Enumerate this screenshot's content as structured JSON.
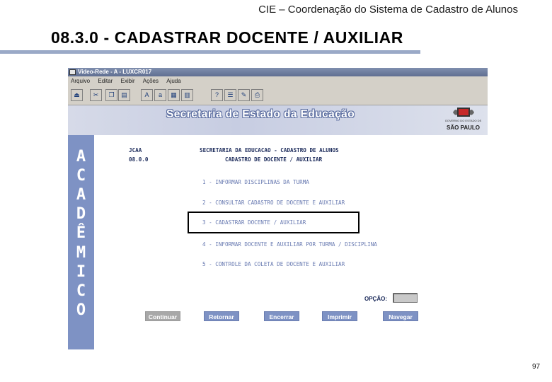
{
  "slide": {
    "header_title": "CIE – Coordenação do Sistema de Cadastro de Alunos",
    "section_title": "08.3.0  -  CADASTRAR DOCENTE / AUXILIAR",
    "page_number": "97"
  },
  "window": {
    "title": "Video-Rede - A - LUXCR017",
    "menu": [
      "Arquivo",
      "Editar",
      "Exibir",
      "Ações",
      "Ajuda"
    ],
    "banner_title": "Secretaria de Estado da Educação",
    "seal_caption": "GOVERNO DO ESTADO DE",
    "seal_state": "SÃO PAULO",
    "sidebar_letters": [
      "A",
      "C",
      "A",
      "D",
      "Ê",
      "M",
      "I",
      "C",
      "O"
    ]
  },
  "screen": {
    "system_code": "JCAA",
    "screen_code": "08.0.0",
    "heading": "SECRETARIA DA EDUCACAO - CADASTRO DE ALUNOS",
    "subheading": "CADASTRO DE DOCENTE / AUXILIAR",
    "options": [
      "1 - INFORMAR DISCIPLINAS DA TURMA",
      "2 - CONSULTAR CADASTRO DE DOCENTE E AUXILIAR",
      "3 - CADASTRAR DOCENTE / AUXILIAR",
      "4 - INFORMAR DOCENTE E AUXILIAR POR TURMA / DISCIPLINA",
      "5 - CONTROLE DA COLETA DE DOCENTE E AUXILIAR"
    ],
    "option_label": "OPÇÃO:",
    "option_value": "",
    "buttons": [
      "Continuar",
      "Retornar",
      "Encerrar",
      "Imprimir",
      "Navegar"
    ]
  },
  "colors": {
    "sidebar": "#7e92c4",
    "button": "#7e92c4",
    "disabled_button": "#a8a8a8",
    "header_rule": "#9aa9c7"
  }
}
